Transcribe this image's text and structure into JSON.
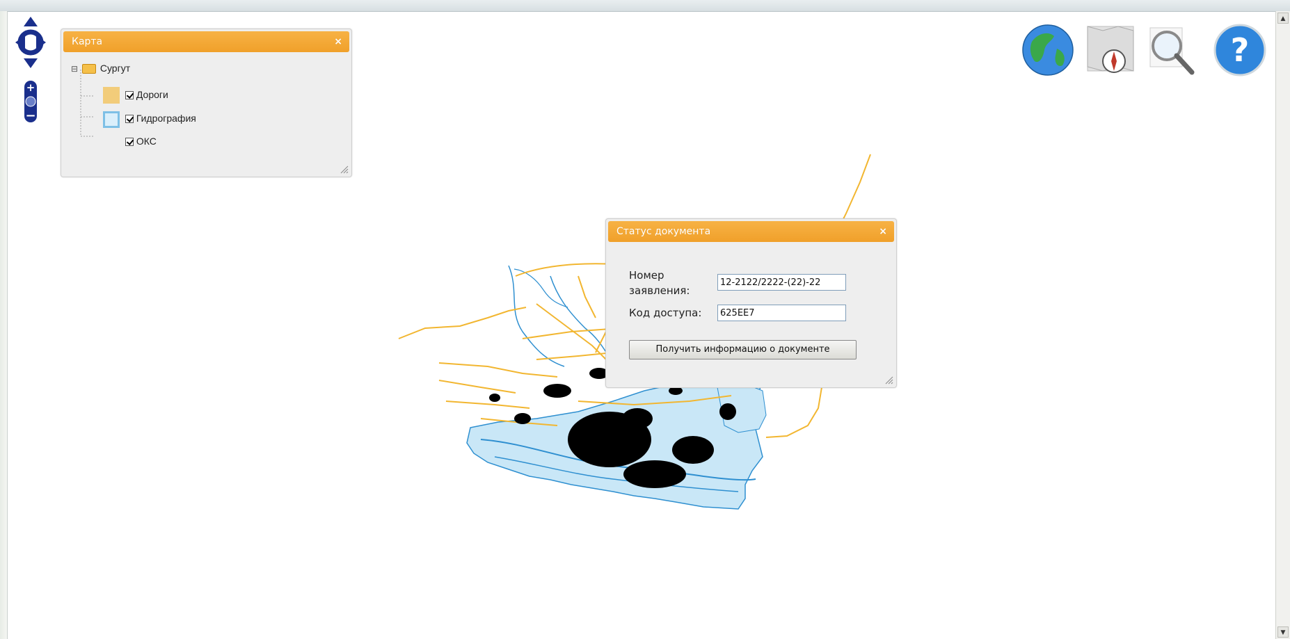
{
  "layer_panel": {
    "title": "Карта",
    "close_symbol": "×",
    "root": {
      "label": "Сургут",
      "icon": "folder-open-icon",
      "expander": "⊟"
    },
    "layers": [
      {
        "label": "Дороги",
        "checked": true,
        "swatch_fill": "#f2cc7a",
        "swatch_border": "#f2cc7a"
      },
      {
        "label": "Гидрография",
        "checked": true,
        "swatch_fill": "#dbeffb",
        "swatch_border": "#7ec0e6"
      },
      {
        "label": "ОКС",
        "checked": true
      }
    ]
  },
  "status_dialog": {
    "title": "Статус документа",
    "close_symbol": "×",
    "application_number_label_line1": "Номер",
    "application_number_label_line2": "заявления:",
    "application_number_value": "12-2122/2222-(22)-22",
    "access_code_label": "Код доступа:",
    "access_code_value": "625EE7",
    "submit_label": "Получить информацию о документе"
  },
  "toolbar": [
    {
      "name": "globe-button",
      "icon": "globe-icon"
    },
    {
      "name": "map-navigation-button",
      "icon": "map-compass-icon"
    },
    {
      "name": "search-button",
      "icon": "magnifier-icon"
    },
    {
      "name": "help-button",
      "icon": "help-icon"
    }
  ],
  "colors": {
    "panel_header": "#f0a02a",
    "roads": "#f2b630",
    "water_fill": "#c9e7f7",
    "water_stroke": "#2e8fd0",
    "buildings": "#000000",
    "nav_control": "#1a2f8c"
  }
}
